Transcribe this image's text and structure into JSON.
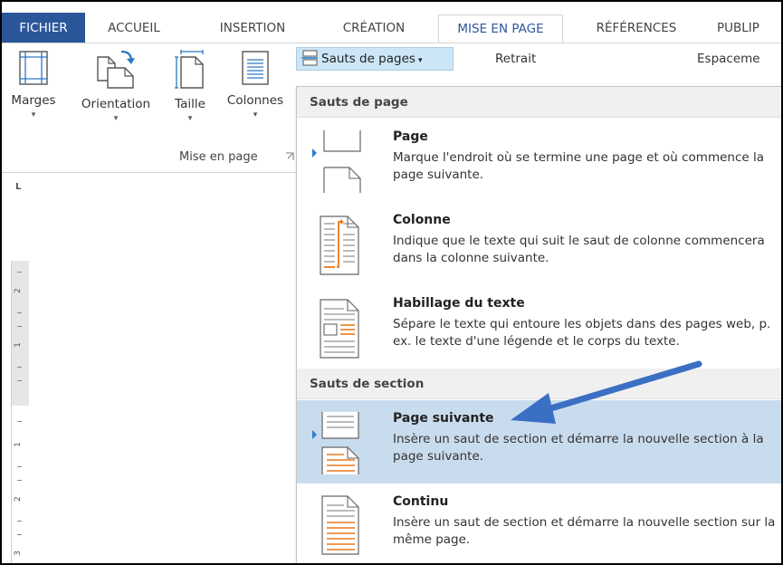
{
  "tabs": [
    {
      "label": "FICHIER"
    },
    {
      "label": "ACCUEIL"
    },
    {
      "label": "INSERTION"
    },
    {
      "label": "CRÉATION"
    },
    {
      "label": "MISE EN PAGE",
      "active": true
    },
    {
      "label": "RÉFÉRENCES"
    },
    {
      "label": "PUBLIP"
    }
  ],
  "ribbon": {
    "margins_label": "Marges",
    "orientation_label": "Orientation",
    "size_label": "Taille",
    "columns_label": "Colonnes",
    "group_label": "Mise en page",
    "breaks_label": "Sauts de pages",
    "indent_label": "Retrait",
    "spacing_label": "Espaceme"
  },
  "ruler": {
    "corner": "L",
    "numbers": [
      "2",
      "1",
      "1",
      "2",
      "3"
    ]
  },
  "dropdown": {
    "page_breaks_header": "Sauts de page",
    "section_breaks_header": "Sauts de section",
    "items": [
      {
        "title": "Page",
        "desc": "Marque l'endroit où se termine une page et où commence la page suivante."
      },
      {
        "title": "Colonne",
        "desc": "Indique que le texte qui suit le saut de colonne commencera dans la colonne suivante."
      },
      {
        "title": "Habillage du texte",
        "desc": "Sépare le texte qui entoure les objets dans des pages web, p. ex. le texte d'une légende et le corps du texte."
      },
      {
        "title": "Page suivante",
        "desc": "Insère un saut de section et démarre la nouvelle section à la page suivante."
      },
      {
        "title": "Continu",
        "desc": "Insère un saut de section et démarre la nouvelle section sur la même page."
      }
    ]
  },
  "colors": {
    "file_tab": "#2b579a",
    "active_tab_text": "#2b579a",
    "highlight": "#c9dcee",
    "arrow": "#3a6fc4",
    "accent_orange": "#e8791e"
  }
}
